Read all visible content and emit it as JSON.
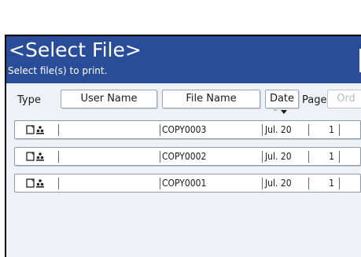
{
  "header": {
    "title": "<Select File>",
    "subtitle": "Select file(s) to print."
  },
  "columns": {
    "type_label": "Type",
    "user_name_label": "User Name",
    "file_name_label": "File Name",
    "date_label": "Date",
    "page_label": "Page",
    "order_label": "Ord"
  },
  "files": [
    {
      "user_name": "",
      "file_name": "COPY0003",
      "date": "Jul. 20",
      "pages": "1"
    },
    {
      "user_name": "",
      "file_name": "COPY0002",
      "date": "Jul. 20",
      "pages": "1"
    },
    {
      "user_name": "",
      "file_name": "COPY0001",
      "date": "Jul. 20",
      "pages": "1"
    }
  ],
  "colors": {
    "title_bar": "#2a4d9a",
    "panel_background": "#eef1f6"
  }
}
